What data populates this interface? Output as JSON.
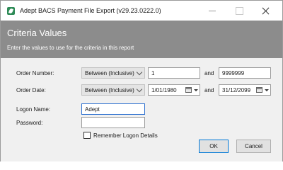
{
  "window": {
    "title": "Adept BACS Payment File Export (v29.23.0222.0)"
  },
  "header": {
    "title": "Criteria Values",
    "subtitle": "Enter the values to use for the criteria in this report"
  },
  "criteria": {
    "order_number": {
      "label": "Order Number:",
      "operator": "Between (Inclusive)",
      "from": "1",
      "and_label": "and",
      "to": "9999999"
    },
    "order_date": {
      "label": "Order Date:",
      "operator": "Between (Inclusive)",
      "from": "1/01/1980",
      "and_label": "and",
      "to": "31/12/2099"
    }
  },
  "logon": {
    "name_label": "Logon Name:",
    "name_value": "Adept",
    "password_label": "Password:",
    "password_value": "",
    "remember_label": "Remember Logon Details",
    "remember_checked": false
  },
  "buttons": {
    "ok": "OK",
    "cancel": "Cancel"
  },
  "colors": {
    "header_bg": "#8c8c8c",
    "focus_border": "#2b6fcf",
    "default_button_border": "#0078d7"
  }
}
